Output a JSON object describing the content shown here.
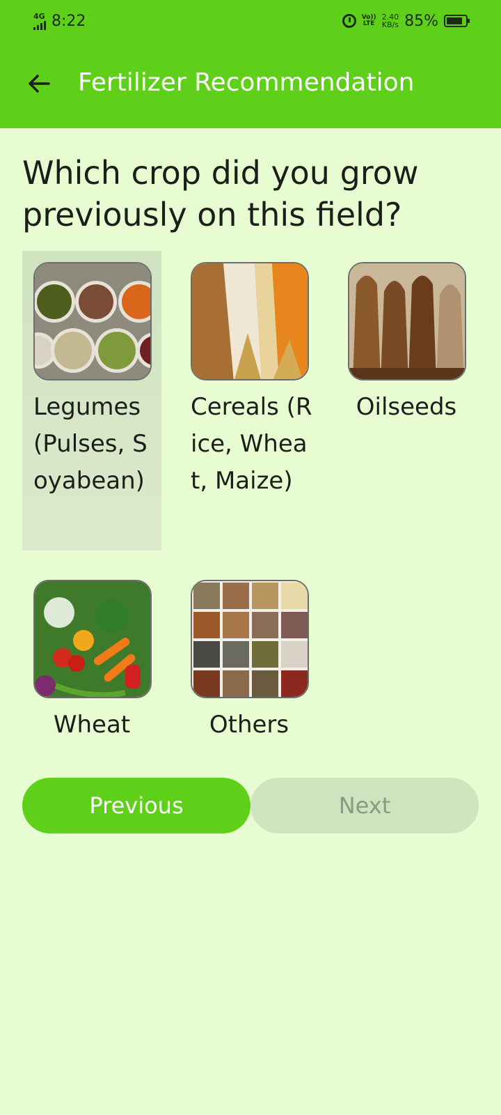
{
  "status_bar": {
    "network": "4G",
    "time": "8:22",
    "volte_top": "Vo))",
    "volte_bottom": "LTE",
    "speed_value": "2.40",
    "speed_unit": "KB/s",
    "battery": "85%"
  },
  "app_bar": {
    "title": "Fertilizer Recommendation",
    "back_icon": "arrow-left-icon"
  },
  "question": "Which crop did you grow previously on this field?",
  "options": [
    {
      "label": "Legumes (Pulses, Soyabean)",
      "selected": true,
      "image": "legumes-photo"
    },
    {
      "label": "Cereals (Rice, Wheat, Maize)",
      "selected": false,
      "image": "cereals-photo"
    },
    {
      "label": "Oilseeds",
      "selected": false,
      "image": "oilseeds-photo"
    },
    {
      "label": "Wheat",
      "selected": false,
      "image": "vegetables-photo"
    },
    {
      "label": "Others",
      "selected": false,
      "image": "others-grid-photo"
    }
  ],
  "buttons": {
    "previous": "Previous",
    "next": "Next"
  },
  "colors": {
    "primary": "#5fd01a",
    "background": "#e8fcd2",
    "disabled_button": "#d0e3bf"
  }
}
